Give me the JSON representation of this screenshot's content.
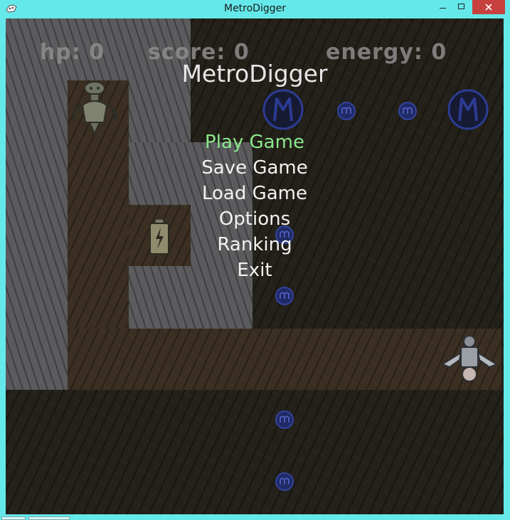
{
  "window": {
    "title": "MetroDigger",
    "minimize_glyph": "–",
    "close_glyph": "✕"
  },
  "hud": {
    "hp": "hp: 0",
    "score": "score: 0",
    "energy": "energy: 0"
  },
  "game_title": "MetroDigger",
  "menu": {
    "items": [
      {
        "label": "Play Game",
        "selected": true
      },
      {
        "label": "Save Game",
        "selected": false
      },
      {
        "label": "Load Game",
        "selected": false
      },
      {
        "label": "Options",
        "selected": false
      },
      {
        "label": "Ranking",
        "selected": false
      },
      {
        "label": "Exit",
        "selected": false
      }
    ]
  },
  "colors": {
    "window_frame": "#65e8ea",
    "close_button": "#c7413f",
    "menu_selected": "#8be88b",
    "menu_default": "#f2f2f2",
    "coin": "#2a3a8a"
  },
  "icons": [
    "app-icon",
    "metro-logo-icon",
    "metro-coin-icon",
    "battery-icon",
    "drill-robot-icon",
    "enemy-robot-icon"
  ]
}
